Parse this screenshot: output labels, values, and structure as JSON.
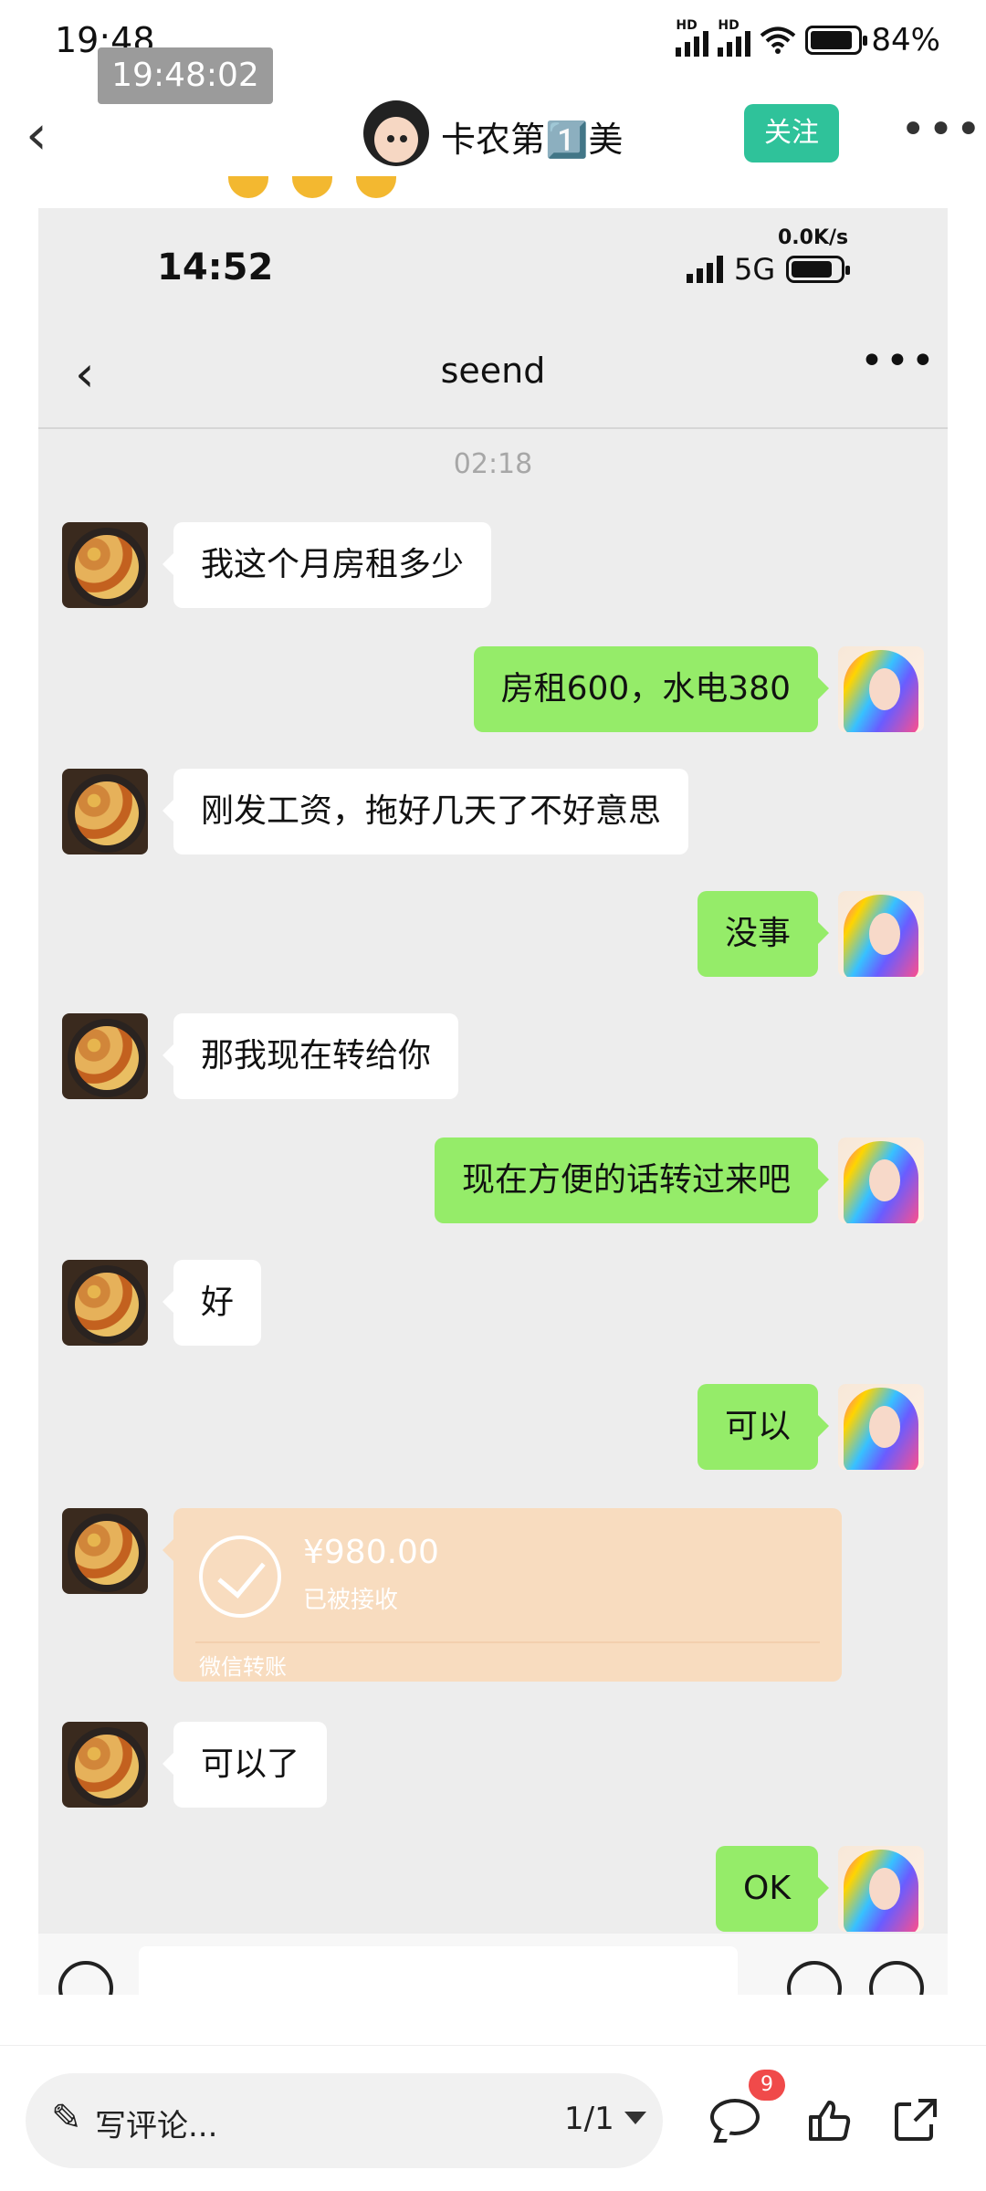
{
  "status_bar": {
    "time": "19:48",
    "badge_time": "19:48:02",
    "battery": "84%"
  },
  "header": {
    "author_name": "卡农第1️⃣美",
    "follow_label": "关注"
  },
  "inner_screenshot": {
    "status": {
      "time": "14:52",
      "speed": "0.0K/s",
      "network": "5G"
    },
    "chat_title": "seend",
    "timestamp": "02:18",
    "messages": [
      {
        "side": "left",
        "text": "我这个月房租多少"
      },
      {
        "side": "right",
        "text": "房租600，水电380"
      },
      {
        "side": "left",
        "text": "刚发工资，拖好几天了不好意思"
      },
      {
        "side": "right",
        "text": "没事"
      },
      {
        "side": "left",
        "text": "那我现在转给你"
      },
      {
        "side": "right",
        "text": "现在方便的话转过来吧"
      },
      {
        "side": "left",
        "text": "好"
      },
      {
        "side": "right",
        "text": "可以"
      },
      {
        "side": "left",
        "text": "可以了"
      },
      {
        "side": "right",
        "text": "OK"
      }
    ],
    "transfer": {
      "amount": "¥980.00",
      "status": "已被接收",
      "label": "微信转账"
    }
  },
  "bottom_bar": {
    "comment_placeholder": "写评论...",
    "page_indicator": "1/1",
    "comment_count": "9"
  },
  "colors": {
    "follow_button": "#2fc29a",
    "right_bubble": "#95ec69",
    "transfer_card": "#f8dcbf",
    "badge": "#f04a4a"
  }
}
